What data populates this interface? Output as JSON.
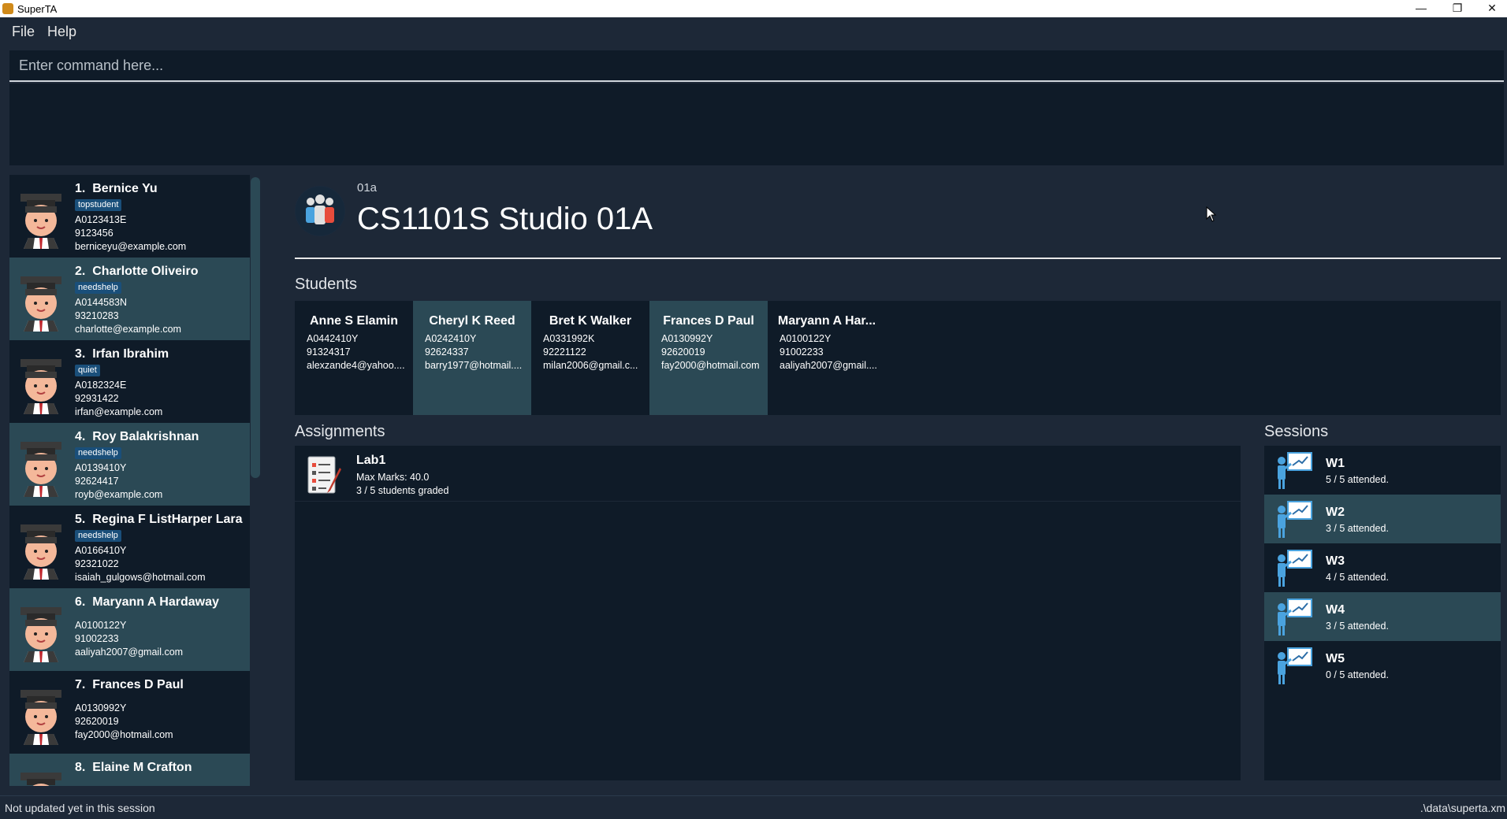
{
  "window": {
    "title": "SuperTA",
    "minimize": "—",
    "restore": "❐",
    "close": "✕"
  },
  "menu": {
    "file": "File",
    "help": "Help"
  },
  "command": {
    "placeholder": "Enter command here..."
  },
  "persons": [
    {
      "index": "1.",
      "name": "Bernice Yu",
      "tag": "topstudent",
      "id": "A0123413E",
      "phone": "9123456",
      "email": "berniceyu@example.com"
    },
    {
      "index": "2.",
      "name": "Charlotte Oliveiro",
      "tag": "needshelp",
      "id": "A0144583N",
      "phone": "93210283",
      "email": "charlotte@example.com"
    },
    {
      "index": "3.",
      "name": "Irfan Ibrahim",
      "tag": "quiet",
      "id": "A0182324E",
      "phone": "92931422",
      "email": "irfan@example.com"
    },
    {
      "index": "4.",
      "name": "Roy Balakrishnan",
      "tag": "needshelp",
      "id": "A0139410Y",
      "phone": "92624417",
      "email": "royb@example.com"
    },
    {
      "index": "5.",
      "name": "Regina F ListHarper Lara",
      "tag": "needshelp",
      "id": "A0166410Y",
      "phone": "92321022",
      "email": "isaiah_gulgows@hotmail.com"
    },
    {
      "index": "6.",
      "name": "Maryann A Hardaway",
      "id": "A0100122Y",
      "phone": "91002233",
      "email": "aaliyah2007@gmail.com"
    },
    {
      "index": "7.",
      "name": "Frances D Paul",
      "id": "A0130992Y",
      "phone": "92620019",
      "email": "fay2000@hotmail.com"
    },
    {
      "index": "8.",
      "name": "Elaine M Crafton"
    }
  ],
  "group": {
    "id": "01a",
    "title": "CS1101S Studio 01A"
  },
  "students_label": "Students",
  "students": [
    {
      "name": "Anne S Elamin",
      "id": "A0442410Y",
      "phone": "91324317",
      "email": "alexzande4@yahoo...."
    },
    {
      "name": "Cheryl K Reed",
      "id": "A0242410Y",
      "phone": "92624337",
      "email": "barry1977@hotmail...."
    },
    {
      "name": "Bret K Walker",
      "id": "A0331992K",
      "phone": "92221122",
      "email": "milan2006@gmail.c..."
    },
    {
      "name": "Frances D Paul",
      "id": "A0130992Y",
      "phone": "92620019",
      "email": "fay2000@hotmail.com"
    },
    {
      "name": "Maryann A Har...",
      "id": "A0100122Y",
      "phone": "91002233",
      "email": "aaliyah2007@gmail...."
    }
  ],
  "assignments_label": "Assignments",
  "assignments": [
    {
      "title": "Lab1",
      "max_marks": "Max Marks: 40.0",
      "graded": "3 / 5 students graded"
    }
  ],
  "sessions_label": "Sessions",
  "sessions": [
    {
      "title": "W1",
      "attended": "5 / 5 attended."
    },
    {
      "title": "W2",
      "attended": "3 / 5 attended."
    },
    {
      "title": "W3",
      "attended": "4 / 5 attended."
    },
    {
      "title": "W4",
      "attended": "3 / 5 attended."
    },
    {
      "title": "W5",
      "attended": "0 / 5 attended."
    }
  ],
  "status": {
    "left": "Not updated yet in this session",
    "right": ".\\data\\superta.xm"
  },
  "colors": {
    "background": "#1d2837",
    "panel": "#0f1b28",
    "selected_card": "#2b4955",
    "tag": "#1a4f7a"
  }
}
